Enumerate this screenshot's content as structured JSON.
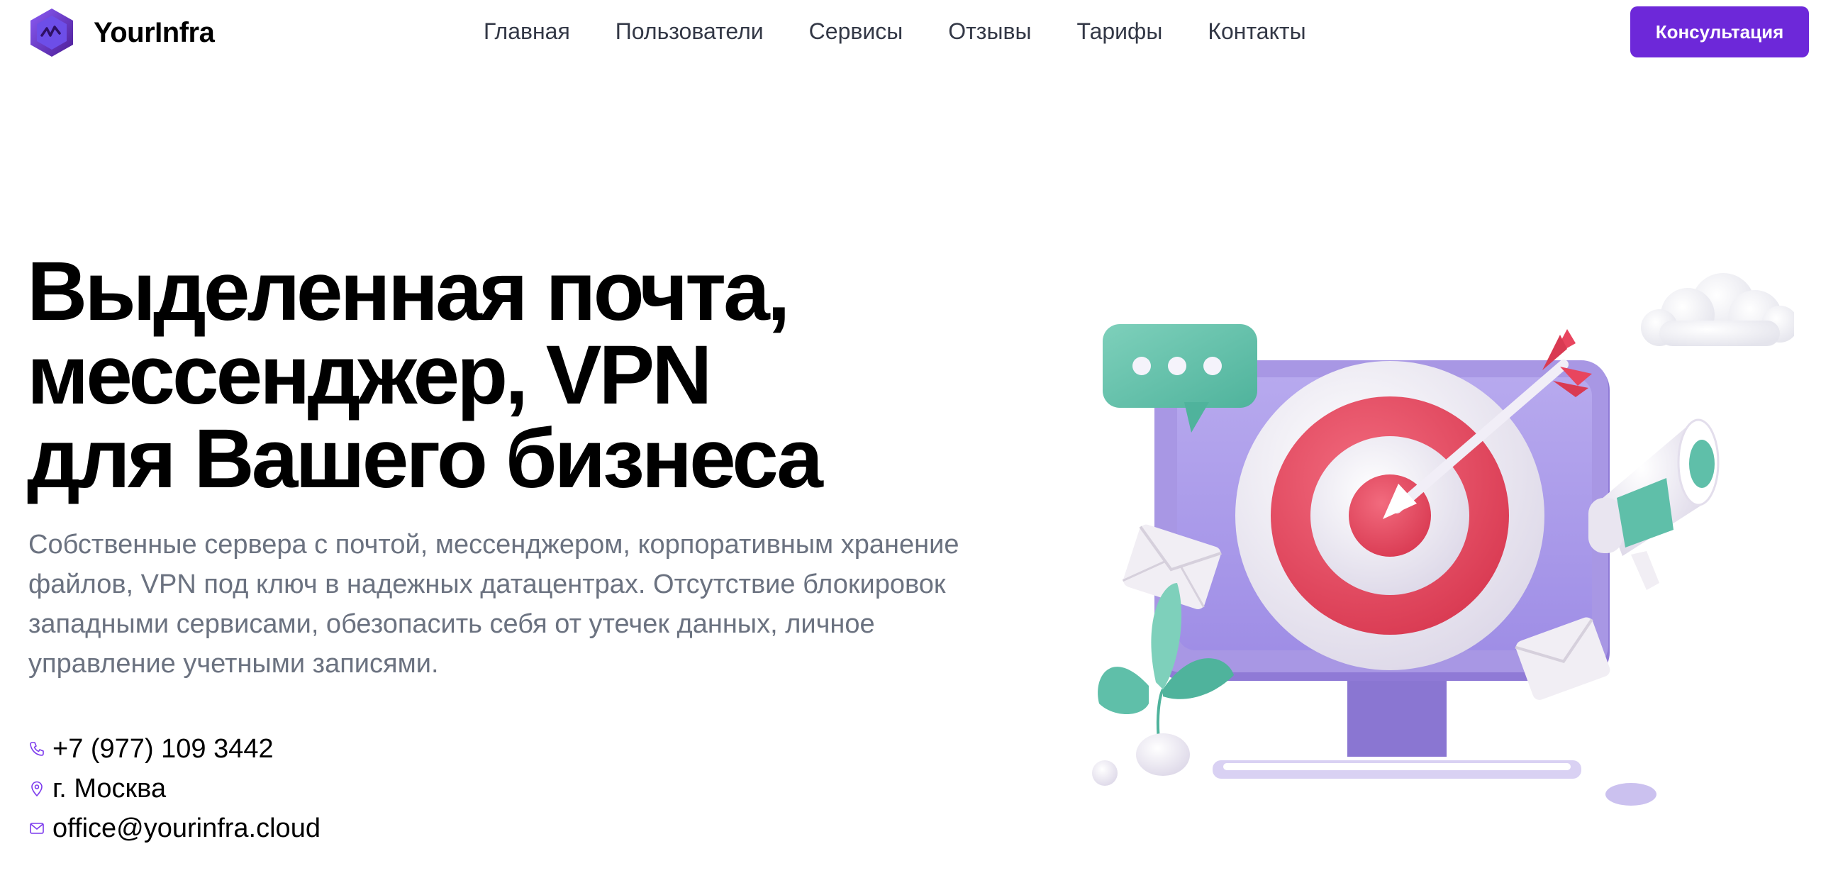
{
  "brand": {
    "name": "YourInfra"
  },
  "nav": {
    "items": [
      "Главная",
      "Пользователи",
      "Сервисы",
      "Отзывы",
      "Тарифы",
      "Контакты"
    ]
  },
  "header": {
    "cta_label": "Консультация"
  },
  "hero": {
    "title_lines": [
      "Выделенная почта,",
      "мессенджер, VPN",
      "для Вашего бизнеса"
    ],
    "description": "Собственные сервера с почтой, мессенджером, корпоративным хранение файлов, VPN под ключ в надежных датацентрах. Отсутствие блокировок западными сервисами, обезопасить себя от утечек данных, личное управление учетными записями."
  },
  "contacts": {
    "phone": "+7 (977) 109 3442",
    "city": "г. Москва",
    "email": "office@yourinfra.cloud"
  },
  "icons": {
    "logo": "hexagon-logo-icon",
    "phone": "phone-icon",
    "location": "map-pin-icon",
    "email": "mail-icon"
  },
  "colors": {
    "accent": "#6d28d9",
    "nav_text": "#333846",
    "muted_text": "#6b7280",
    "target_red": "#e8455e",
    "monitor_purple": "#8f7ad6",
    "bubble_teal": "#5fbfa9"
  }
}
